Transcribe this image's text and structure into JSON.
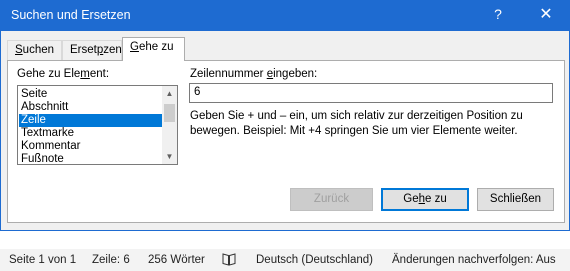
{
  "window": {
    "title": "Suchen und Ersetzen",
    "help_glyph": "?",
    "close_glyph": "✕"
  },
  "tabs": [
    {
      "label": "Suchen",
      "accel": "S",
      "rest": "uchen",
      "active": false
    },
    {
      "label": "Ersetzen",
      "accel": "p",
      "pre": "Erset",
      "post": "zen",
      "active": false
    },
    {
      "label": "Gehe zu",
      "accel": "G",
      "rest": "ehe zu",
      "active": true
    }
  ],
  "goto": {
    "element_label_pre": "Gehe zu Ele",
    "element_label_accel": "m",
    "element_label_post": "ent:",
    "elements": [
      "Seite",
      "Abschnitt",
      "Zeile",
      "Textmarke",
      "Kommentar",
      "Fußnote"
    ],
    "selected_element": "Zeile",
    "number_label_pre": "Zeilennummer ",
    "number_label_accel": "e",
    "number_label_post": "ingeben:",
    "number_value": "6",
    "help_text": "Geben Sie + und – ein, um sich relativ zur derzeitigen Position zu bewegen. Beispiel: Mit +4 springen Sie um vier Elemente weiter."
  },
  "buttons": {
    "back_label": "Zurück",
    "goto_label_pre": "Ge",
    "goto_label_accel": "h",
    "goto_label_post": "e zu",
    "close_label": "Schließen"
  },
  "statusbar": {
    "page": "Seite 1 von 1",
    "line": "Zeile: 6",
    "words": "256 Wörter",
    "proofing_icon": "book-icon",
    "language": "Deutsch (Deutschland)",
    "track_changes": "Änderungen nachverfolgen: Aus"
  },
  "colors": {
    "titlebar": "#1e6bd1",
    "selection": "#0078d7"
  }
}
